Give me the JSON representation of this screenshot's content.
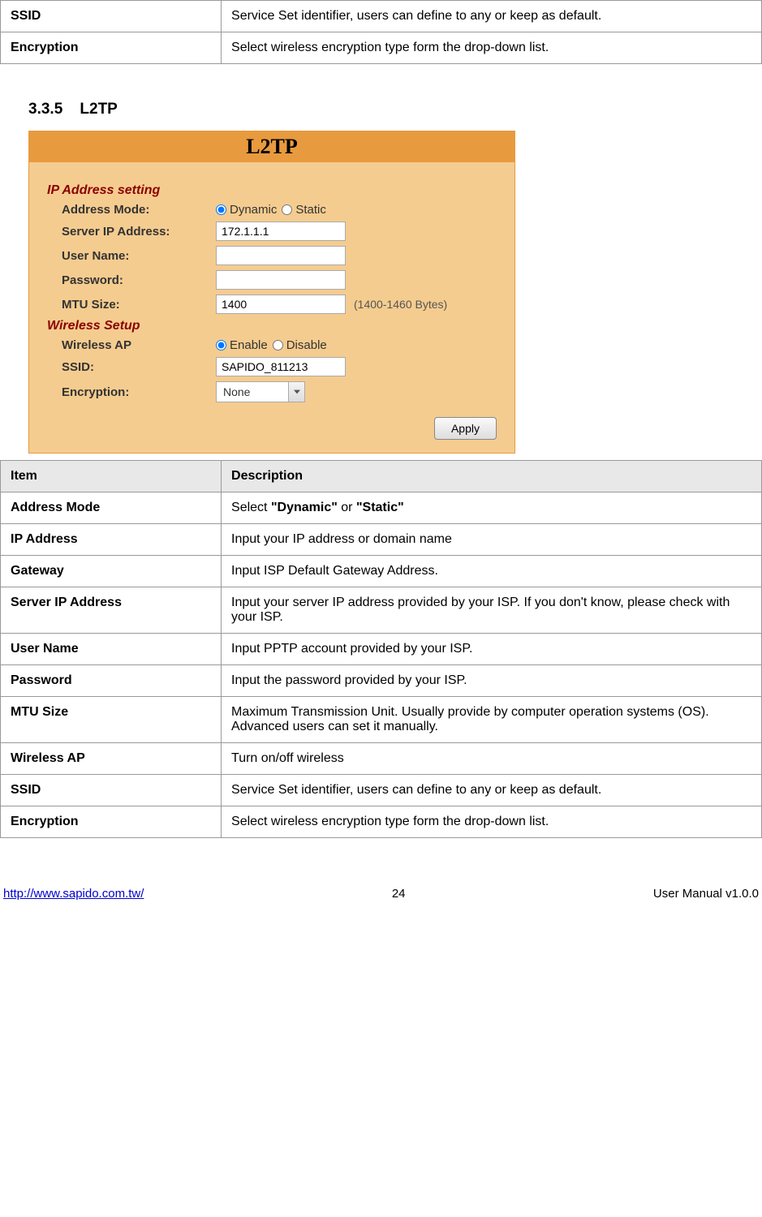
{
  "top_table": [
    {
      "item": "SSID",
      "desc": "Service Set identifier, users can define to any or keep as default."
    },
    {
      "item": "Encryption",
      "desc": "Select wireless encryption type form the drop-down list."
    }
  ],
  "section_number": "3.3.5",
  "section_title": "L2TP",
  "screenshot_title": "L2TP",
  "section1_label": "IP Address setting",
  "section2_label": "Wireless Setup",
  "labels": {
    "address_mode": "Address Mode:",
    "server_ip": "Server IP Address:",
    "user_name": "User Name:",
    "password": "Password:",
    "mtu_size": "MTU Size:",
    "mtu_hint": "(1400-1460 Bytes)",
    "wireless_ap": "Wireless AP",
    "ssid": "SSID:",
    "encryption": "Encryption:"
  },
  "radio_dynamic": "Dynamic",
  "radio_static": "Static",
  "radio_enable": "Enable",
  "radio_disable": "Disable",
  "values": {
    "server_ip": "172.1.1.1",
    "user_name": "",
    "password": "",
    "mtu": "1400",
    "ssid": "SAPIDO_811213",
    "encryption": "None"
  },
  "apply_label": "Apply",
  "desc_header_item": "Item",
  "desc_header_desc": "Description",
  "desc_rows": [
    {
      "item": "Address Mode",
      "desc_prefix": "Select ",
      "bold1": "\"Dynamic\"",
      "mid": " or ",
      "bold2": "\"Static\""
    },
    {
      "item": "IP Address",
      "desc": "Input your IP address or domain name"
    },
    {
      "item": "Gateway",
      "desc": "Input ISP Default Gateway Address."
    },
    {
      "item": "Server IP Address",
      "desc": "Input your server IP address provided by your ISP.    If you don't know, please check with your ISP."
    },
    {
      "item": "User Name",
      "desc": "Input PPTP account provided by your ISP."
    },
    {
      "item": "Password",
      "desc": "Input the password provided by your ISP."
    },
    {
      "item": "MTU Size",
      "desc": "Maximum Transmission Unit. Usually provide by computer operation systems (OS). Advanced users can set it manually."
    },
    {
      "item": "Wireless AP",
      "desc": "Turn on/off wireless"
    },
    {
      "item": "SSID",
      "desc": "Service Set identifier, users can define to any or keep as default."
    },
    {
      "item": "Encryption",
      "desc": "Select wireless encryption type form the drop-down list."
    }
  ],
  "footer": {
    "url": "http://www.sapido.com.tw/",
    "page": "24",
    "right": "User Manual v1.0.0"
  }
}
